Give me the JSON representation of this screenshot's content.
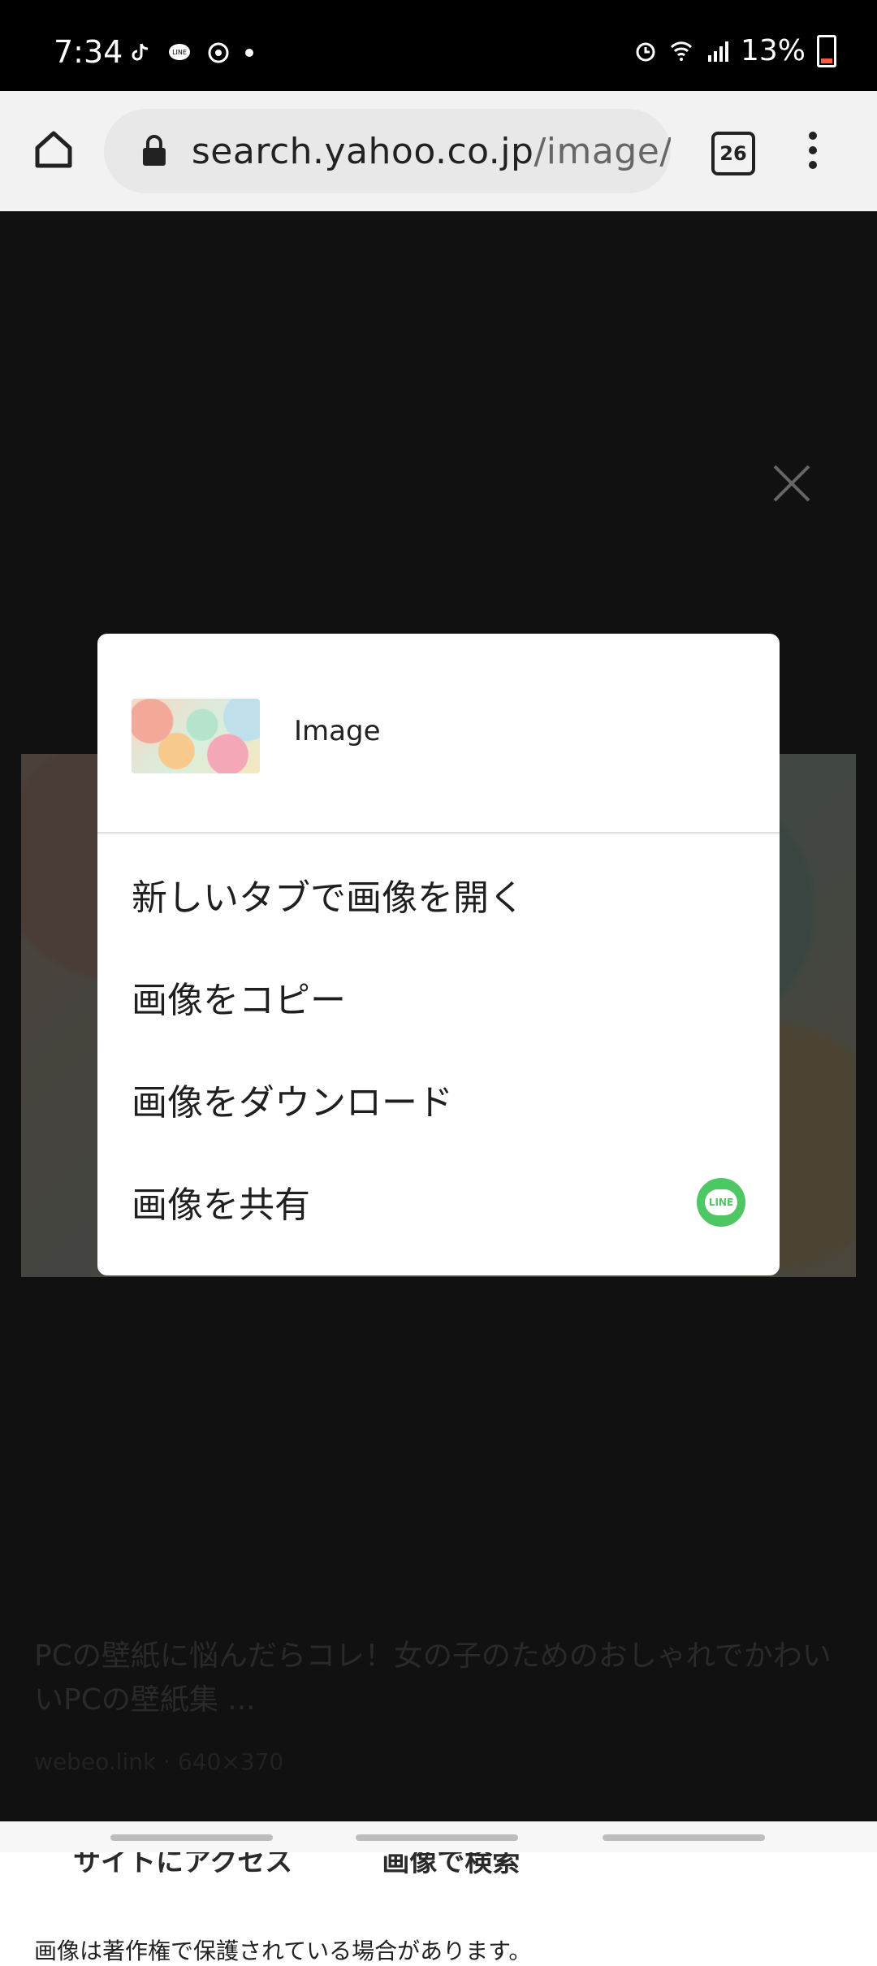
{
  "status_bar": {
    "time": "7:34",
    "battery": "13%",
    "icons_left": [
      "tiktok-icon",
      "line-icon",
      "circle-icon",
      "dot"
    ],
    "icons_right": [
      "alarm-icon",
      "wifi-icon",
      "signal-icon",
      "battery-icon"
    ]
  },
  "browser": {
    "url_host": "search.yahoo.co.jp",
    "url_path": "/image/",
    "tab_count": "26"
  },
  "background_page": {
    "title": "PCの壁紙に悩んだらコレ！女の子のためのおしゃれでかわいいPCの壁紙集 ...",
    "meta": "webeo.link · 640×370",
    "actions": [
      "サイトにアクセス",
      "画像で検索"
    ],
    "note": "画像は著作権で保護されている場合があります。"
  },
  "dialog": {
    "header_label": "Image",
    "items": [
      {
        "label": "新しいタブで画像を開く"
      },
      {
        "label": "画像をコピー"
      },
      {
        "label": "画像をダウンロード"
      },
      {
        "label": "画像を共有"
      }
    ],
    "share_app": "LINE"
  },
  "colors": {
    "accent_line": "#4cc764",
    "overlay": "#111111"
  }
}
